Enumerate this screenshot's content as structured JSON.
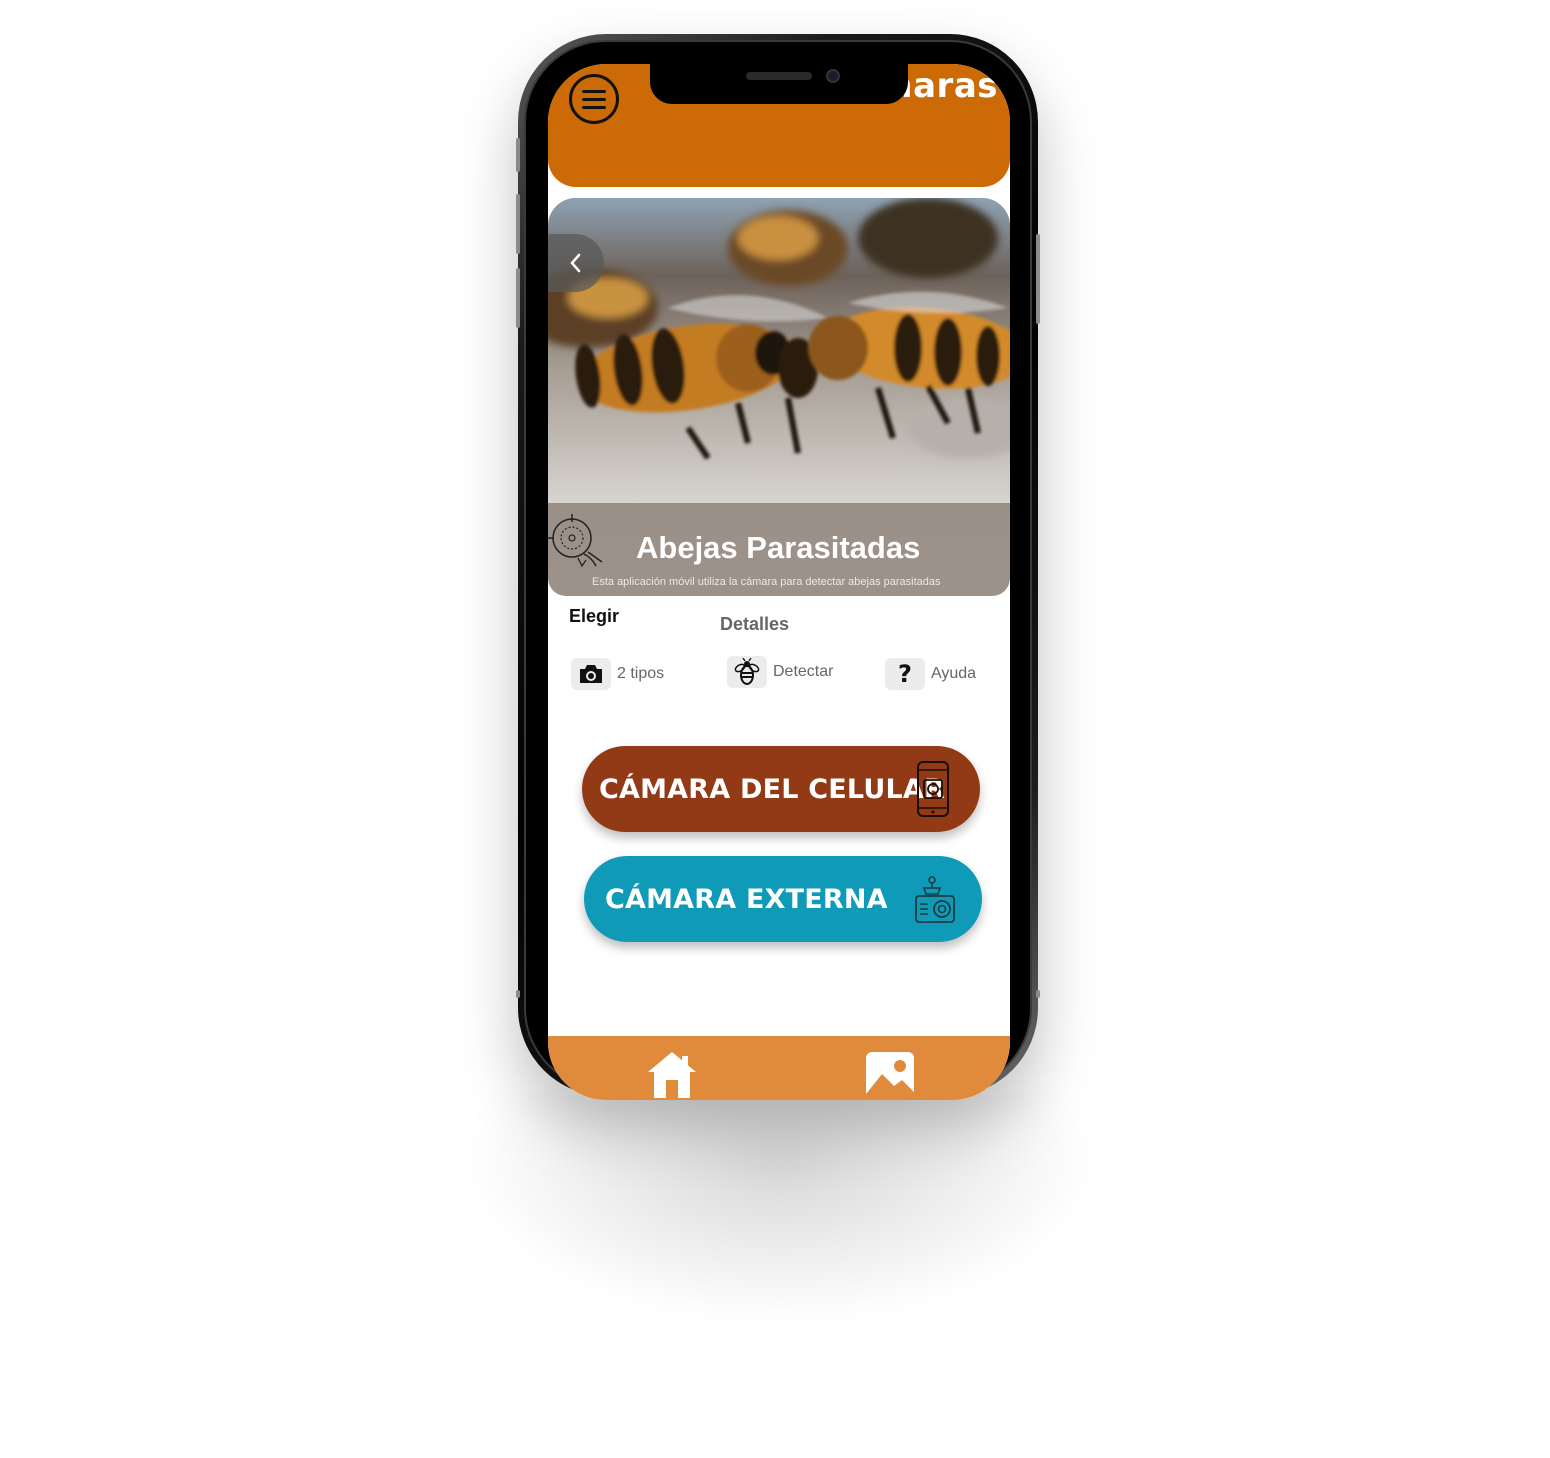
{
  "header": {
    "title": "Cámaras"
  },
  "hero": {
    "title": "Abejas Parasitadas",
    "subtitle": "Esta aplicación móvil utiliza la cámara para detectar abejas parasitadas"
  },
  "tabs": [
    {
      "label": "Elegir"
    },
    {
      "label": "Detalles"
    }
  ],
  "features": [
    {
      "icon": "camera-icon",
      "label": "2 tipos"
    },
    {
      "icon": "bee-icon",
      "label": "Detectar"
    },
    {
      "icon": "help-icon",
      "label": "Ayuda"
    }
  ],
  "actions": [
    {
      "label": "CÁMARA DEL CELULAR",
      "icon": "phone-camera-icon",
      "color": "#923a16"
    },
    {
      "label": "CÁMARA EXTERNA",
      "icon": "external-camera-icon",
      "color": "#0f9ab7"
    }
  ],
  "nav": [
    {
      "icon": "home-icon"
    },
    {
      "icon": "gallery-icon"
    }
  ],
  "colors": {
    "header": "#cc6b05",
    "bottom_nav": "#e08a3c"
  }
}
